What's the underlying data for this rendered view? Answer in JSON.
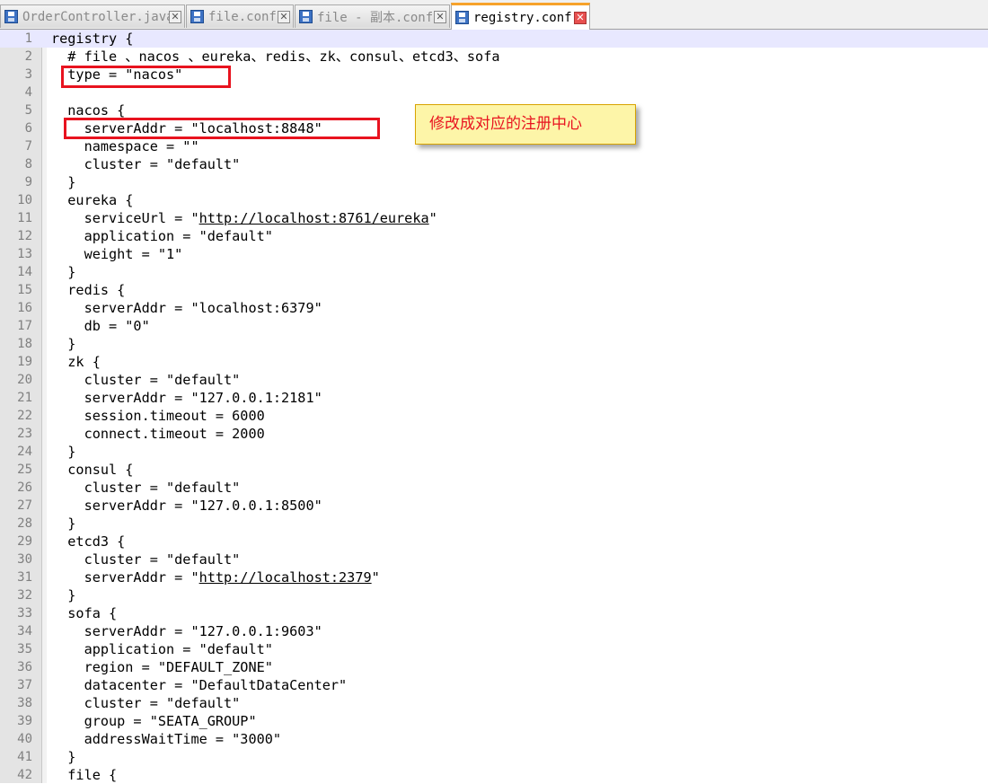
{
  "tabs": [
    {
      "label": "OrderController.java",
      "active": false
    },
    {
      "label": "file.conf",
      "active": false
    },
    {
      "label": "file - 副本.conf",
      "active": false
    },
    {
      "label": "registry.conf",
      "active": true
    }
  ],
  "tab_close_glyph": "✕",
  "icons": {
    "tab_file": "save-icon",
    "tab_close": "close-icon"
  },
  "colors": {
    "annotation": "#e8131f",
    "callout_bg": "#fdf5a8",
    "active_tab_accent": "#f7a22a"
  },
  "annotation": {
    "callout_text": "修改成对应的注册中心"
  },
  "editor": {
    "lines": [
      {
        "n": "1",
        "text": "registry {"
      },
      {
        "n": "2",
        "text": "  # file 、nacos 、eureka、redis、zk、consul、etcd3、sofa"
      },
      {
        "n": "3",
        "text": "  type = \"nacos\""
      },
      {
        "n": "4",
        "text": ""
      },
      {
        "n": "5",
        "text": "  nacos {"
      },
      {
        "n": "6",
        "text": "    serverAddr = \"localhost:8848\""
      },
      {
        "n": "7",
        "text": "    namespace = \"\""
      },
      {
        "n": "8",
        "text": "    cluster = \"default\""
      },
      {
        "n": "9",
        "text": "  }"
      },
      {
        "n": "10",
        "text": "  eureka {"
      },
      {
        "n": "11",
        "text": "    serviceUrl = \"",
        "link": "http://localhost:8761/eureka",
        "after": "\""
      },
      {
        "n": "12",
        "text": "    application = \"default\""
      },
      {
        "n": "13",
        "text": "    weight = \"1\""
      },
      {
        "n": "14",
        "text": "  }"
      },
      {
        "n": "15",
        "text": "  redis {"
      },
      {
        "n": "16",
        "text": "    serverAddr = \"localhost:6379\""
      },
      {
        "n": "17",
        "text": "    db = \"0\""
      },
      {
        "n": "18",
        "text": "  }"
      },
      {
        "n": "19",
        "text": "  zk {"
      },
      {
        "n": "20",
        "text": "    cluster = \"default\""
      },
      {
        "n": "21",
        "text": "    serverAddr = \"127.0.0.1:2181\""
      },
      {
        "n": "22",
        "text": "    session.timeout = 6000"
      },
      {
        "n": "23",
        "text": "    connect.timeout = 2000"
      },
      {
        "n": "24",
        "text": "  }"
      },
      {
        "n": "25",
        "text": "  consul {"
      },
      {
        "n": "26",
        "text": "    cluster = \"default\""
      },
      {
        "n": "27",
        "text": "    serverAddr = \"127.0.0.1:8500\""
      },
      {
        "n": "28",
        "text": "  }"
      },
      {
        "n": "29",
        "text": "  etcd3 {"
      },
      {
        "n": "30",
        "text": "    cluster = \"default\""
      },
      {
        "n": "31",
        "text": "    serverAddr = \"",
        "link": "http://localhost:2379",
        "after": "\""
      },
      {
        "n": "32",
        "text": "  }"
      },
      {
        "n": "33",
        "text": "  sofa {"
      },
      {
        "n": "34",
        "text": "    serverAddr = \"127.0.0.1:9603\""
      },
      {
        "n": "35",
        "text": "    application = \"default\""
      },
      {
        "n": "36",
        "text": "    region = \"DEFAULT_ZONE\""
      },
      {
        "n": "37",
        "text": "    datacenter = \"DefaultDataCenter\""
      },
      {
        "n": "38",
        "text": "    cluster = \"default\""
      },
      {
        "n": "39",
        "text": "    group = \"SEATA_GROUP\""
      },
      {
        "n": "40",
        "text": "    addressWaitTime = \"3000\""
      },
      {
        "n": "41",
        "text": "  }"
      },
      {
        "n": "42",
        "text": "  file {"
      }
    ]
  }
}
